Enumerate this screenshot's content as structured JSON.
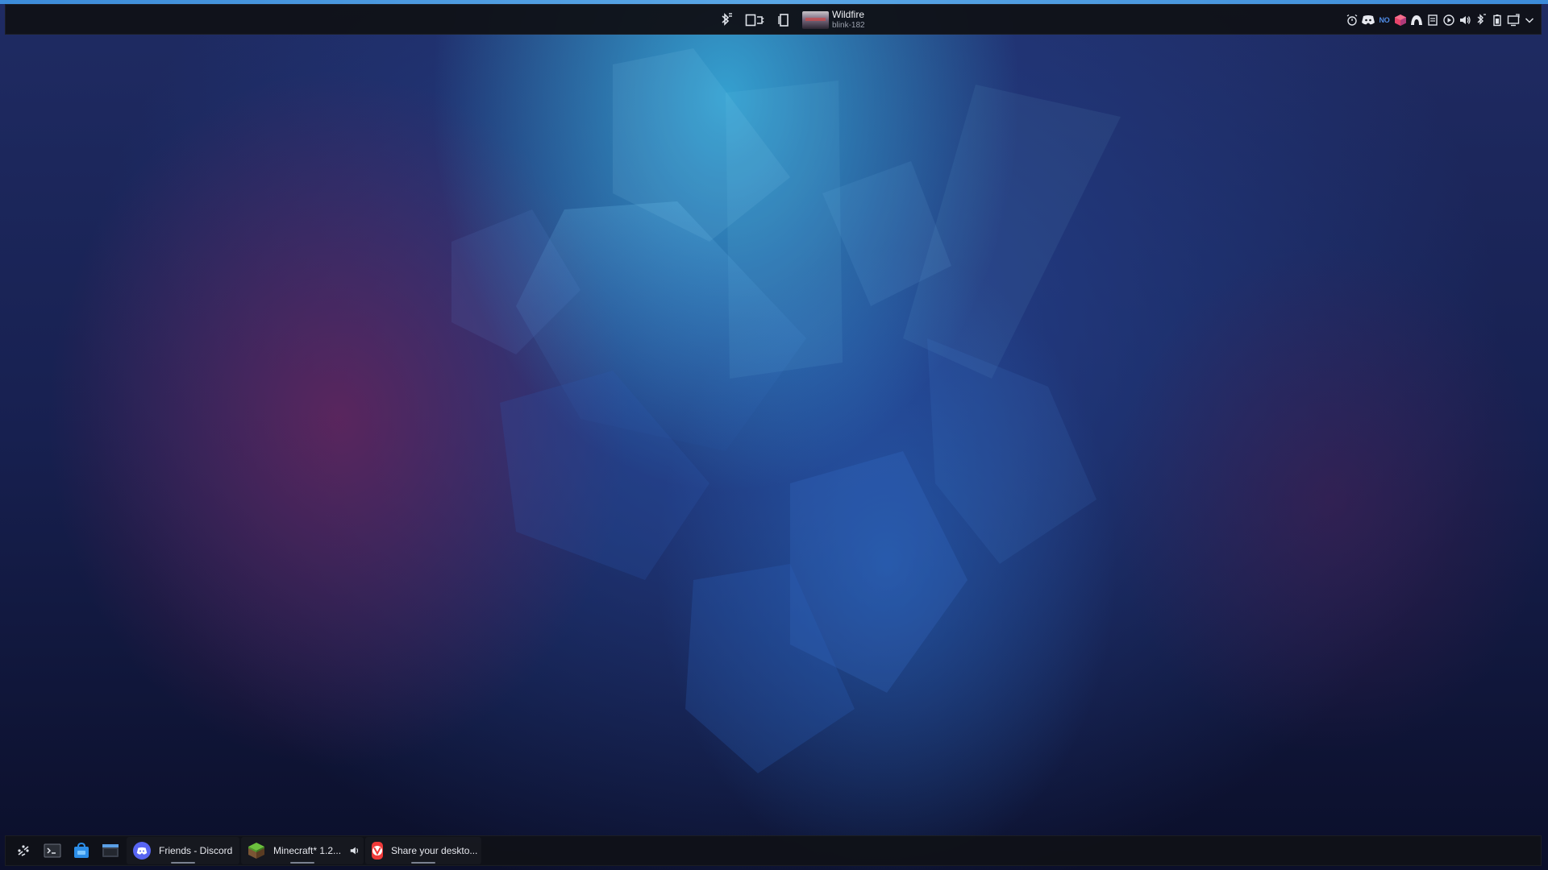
{
  "colors": {
    "panel_bg": "#101218",
    "accent_bar": "#3c8bd9",
    "discord_blurple": "#5865f2",
    "vivaldi_red": "#ef3939",
    "minecraft_green": "#5fa83a"
  },
  "top_panel": {
    "center": {
      "icons": [
        "bluetooth-icon",
        "display-config-icon",
        "window-icon"
      ],
      "now_playing": {
        "title": "Wildfire",
        "artist": "blink-182"
      }
    },
    "system_tray": {
      "icons": [
        "alarm-icon",
        "discord-tray-icon",
        "nordvpn-icon",
        "app-cube-icon",
        "steam-icon",
        "notes-icon",
        "media-play-icon",
        "volume-icon",
        "bluetooth-tray-icon",
        "battery-icon",
        "display-tray-icon",
        "expand-tray-icon"
      ],
      "no_badge": "NO"
    }
  },
  "taskbar": {
    "pinned": [
      "app-launcher-icon",
      "terminal-icon",
      "discover-store-icon",
      "file-manager-icon"
    ],
    "tasks": [
      {
        "label": "Friends - Discord",
        "icon": "discord-icon"
      },
      {
        "label": "Minecraft* 1.2...",
        "icon": "minecraft-icon",
        "audio": "speaker-icon"
      },
      {
        "label": "Share your deskto...",
        "icon": "vivaldi-icon"
      }
    ]
  }
}
